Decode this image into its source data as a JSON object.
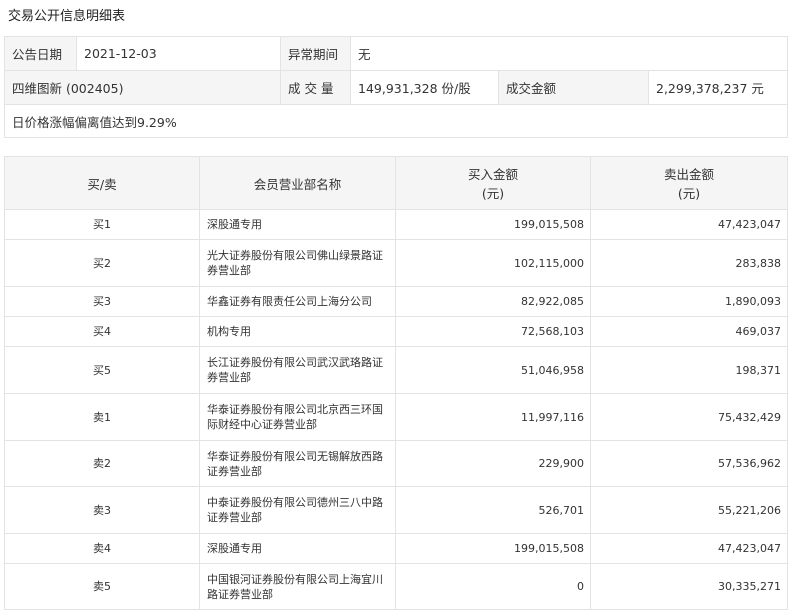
{
  "title": "交易公开信息明细表",
  "info": {
    "date_label": "公告日期",
    "date_value": "2021-12-03",
    "period_label": "异常期间",
    "period_value": "无",
    "stock": "四维图新 (002405)",
    "volume_label": "成 交 量",
    "volume_value": "149,931,328 份/股",
    "amount_label": "成交金额",
    "amount_value": "2,299,378,237 元",
    "note": "日价格涨幅偏离值达到9.29%"
  },
  "table": {
    "headers": [
      "买/卖",
      "会员营业部名称",
      "买入金额\n(元)",
      "卖出金额\n(元)"
    ],
    "rows": [
      {
        "side": "买1",
        "name": "深股通专用",
        "buy": "199,015,508",
        "sell": "47,423,047"
      },
      {
        "side": "买2",
        "name": "光大证券股份有限公司佛山绿景路证券营业部",
        "buy": "102,115,000",
        "sell": "283,838"
      },
      {
        "side": "买3",
        "name": "华鑫证券有限责任公司上海分公司",
        "buy": "82,922,085",
        "sell": "1,890,093"
      },
      {
        "side": "买4",
        "name": "机构专用",
        "buy": "72,568,103",
        "sell": "469,037"
      },
      {
        "side": "买5",
        "name": "长江证券股份有限公司武汉武珞路证券营业部",
        "buy": "51,046,958",
        "sell": "198,371"
      },
      {
        "side": "卖1",
        "name": "华泰证券股份有限公司北京西三环国际财经中心证券营业部",
        "buy": "11,997,116",
        "sell": "75,432,429"
      },
      {
        "side": "卖2",
        "name": "华泰证券股份有限公司无锡解放西路证券营业部",
        "buy": "229,900",
        "sell": "57,536,962"
      },
      {
        "side": "卖3",
        "name": "中泰证券股份有限公司德州三八中路证券营业部",
        "buy": "526,701",
        "sell": "55,221,206"
      },
      {
        "side": "卖4",
        "name": "深股通专用",
        "buy": "199,015,508",
        "sell": "47,423,047"
      },
      {
        "side": "卖5",
        "name": "中国银河证券股份有限公司上海宜川路证券营业部",
        "buy": "0",
        "sell": "30,335,271"
      }
    ]
  }
}
